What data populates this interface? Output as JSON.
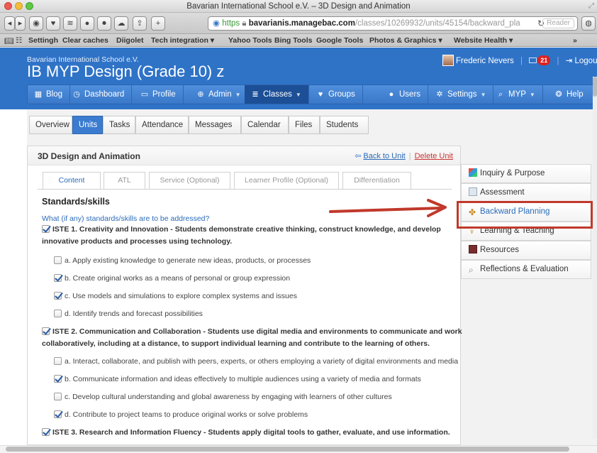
{
  "window": {
    "title": "Bavarian International School e.V. – 3D Design and Animation"
  },
  "browser": {
    "url_protocol": "https",
    "url_host": "bavarianis.managebac.com",
    "url_path": "/classes/10269932/units/45154/backward_pla",
    "reader_label": "Reader",
    "bookmarks": [
      "Settingh",
      "Clear caches",
      "Diigolet",
      "Tech integration ▾",
      "Yahoo Tools",
      "Bing Tools",
      "Google Tools",
      "Photos & Graphics ▾",
      "Website Health ▾"
    ],
    "bookmarks_overflow": "»"
  },
  "site": {
    "school_name": "Bavarian International School e.V.",
    "course_title": "IB MYP Design (Grade 10) z",
    "user_name": "Frederic Nevers",
    "mail_count": "21",
    "logout_label": "Logout",
    "nav": [
      {
        "label": "Blog",
        "icon": "blog-icon"
      },
      {
        "label": "Dashboard",
        "icon": "dashboard-icon"
      },
      {
        "label": "Profile",
        "icon": "profile-icon"
      },
      {
        "label": "Admin",
        "icon": "globe-icon"
      },
      {
        "label": "Classes",
        "icon": "classes-icon"
      },
      {
        "label": "Groups",
        "icon": "groups-icon"
      },
      {
        "label": "Users",
        "icon": "users-icon"
      },
      {
        "label": "Settings",
        "icon": "gear-icon"
      },
      {
        "label": "MYP",
        "icon": "search-icon"
      },
      {
        "label": "Help",
        "icon": "help-icon"
      }
    ]
  },
  "class_tabs": [
    "Overview",
    "Units",
    "Tasks",
    "Attendance",
    "Messages",
    "Calendar",
    "Files",
    "Students"
  ],
  "unit": {
    "title": "3D Design and Animation",
    "back_label": "Back to Unit",
    "delete_label": "Delete Unit",
    "subtabs": [
      "Content",
      "ATL",
      "Service (Optional)",
      "Learner Profile (Optional)",
      "Differentiation"
    ],
    "section_title": "Standards/skills",
    "section_question": "What (if any) standards/skills are to be addressed?",
    "lines": [
      {
        "text": "ISTE 1. Creativity and Innovation - Students demonstrate creative thinking, construct knowledge, and develop",
        "checked": true,
        "bold": true
      },
      {
        "text": "innovative products and processes using technology.",
        "bold": true
      },
      {
        "text": "a. Apply existing knowledge to generate new ideas, products, or processes",
        "checked": false
      },
      {
        "text": "b. Create original works as a means of personal or group expression",
        "checked": true
      },
      {
        "text": "c. Use models and simulations to explore complex systems and issues",
        "checked": true
      },
      {
        "text": "d. Identify trends and forecast possibilities",
        "checked": false
      },
      {
        "text": "ISTE 2. Communication and Collaboration - Students use digital media and environments to communicate and work",
        "checked": true,
        "bold": true
      },
      {
        "text": "collaboratively, including at a distance, to support individual learning and contribute to the learning of others.",
        "bold": true
      },
      {
        "text": "a. Interact, collaborate, and publish with peers, experts, or others employing a variety of digital environments and media",
        "checked": false
      },
      {
        "text": "b. Communicate information and ideas effectively to multiple audiences using a variety of media and formats",
        "checked": true
      },
      {
        "text": "c. Develop cultural understanding and global awareness by engaging with learners of other cultures",
        "checked": false
      },
      {
        "text": "d. Contribute to project teams to produce original works or solve problems",
        "checked": true
      },
      {
        "text": "ISTE 3. Research and Information Fluency - Students apply digital tools to gather, evaluate, and use information.",
        "checked": true,
        "bold": true
      }
    ]
  },
  "sidebar": [
    {
      "label": "Inquiry & Purpose",
      "icon": "inquiry-icon"
    },
    {
      "label": "Assessment",
      "icon": "assessment-icon"
    },
    {
      "label": "Backward Planning",
      "icon": "backward-planning-icon",
      "highlight": true
    },
    {
      "label": "Learning & Teaching",
      "icon": "learning-icon"
    },
    {
      "label": "Resources",
      "icon": "resources-icon"
    },
    {
      "label": "Reflections & Evaluation",
      "icon": "reflection-icon"
    }
  ],
  "colors": {
    "brand_blue": "#2f73c7",
    "annotation_red": "#c0392b"
  }
}
